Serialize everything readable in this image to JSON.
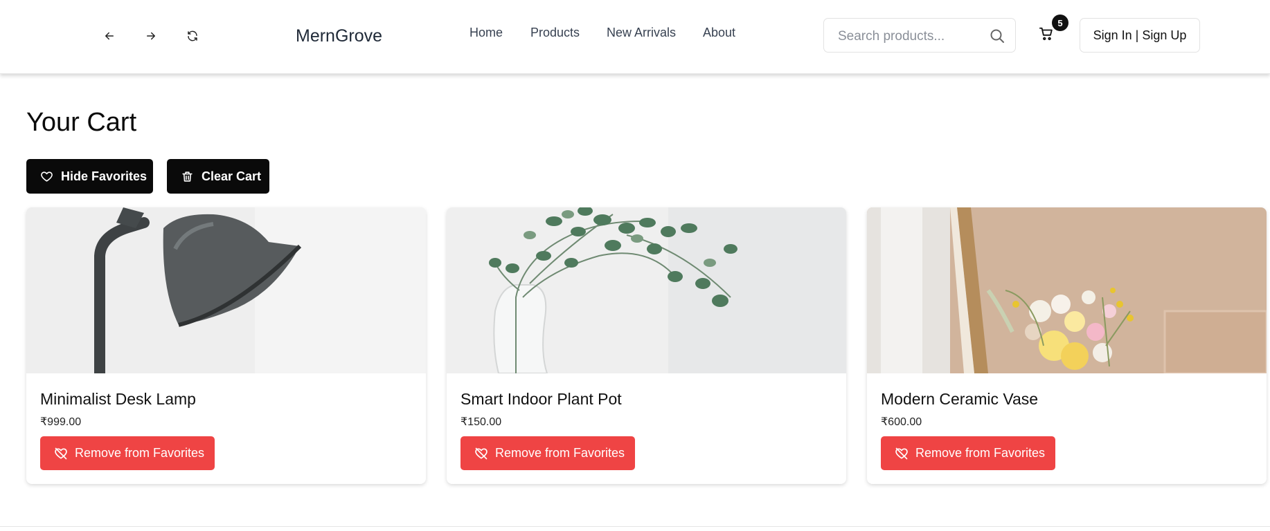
{
  "header": {
    "back_icon": "arrow-left-icon",
    "forward_icon": "arrow-right-icon",
    "refresh_icon": "refresh-icon",
    "brand": "MernGrove",
    "nav": [
      "Home",
      "Products",
      "New Arrivals",
      "About"
    ],
    "search": {
      "placeholder": "Search products...",
      "value": "",
      "icon": "search-icon"
    },
    "cart": {
      "icon": "cart-icon",
      "count": "5"
    },
    "signin_label": "Sign In | Sign Up"
  },
  "main": {
    "title": "Your Cart",
    "hide_favorites_label": "Hide Favorites",
    "hide_favorites_icon": "heart-icon",
    "clear_cart_label": "Clear Cart",
    "clear_cart_icon": "trash-icon",
    "products": [
      {
        "name": "Minimalist Desk Lamp",
        "price": "₹999.00",
        "remove_label": "Remove from Favorites",
        "image": "desk-lamp-photo"
      },
      {
        "name": "Smart Indoor Plant Pot",
        "price": "₹150.00",
        "remove_label": "Remove from Favorites",
        "image": "plant-vase-photo"
      },
      {
        "name": "Modern Ceramic Vase",
        "price": "₹600.00",
        "remove_label": "Remove from Favorites",
        "image": "flower-vase-photo"
      }
    ]
  },
  "colors": {
    "accent_dark": "#0a0a0a",
    "remove_red": "#ef4444",
    "badge": "#111111"
  }
}
